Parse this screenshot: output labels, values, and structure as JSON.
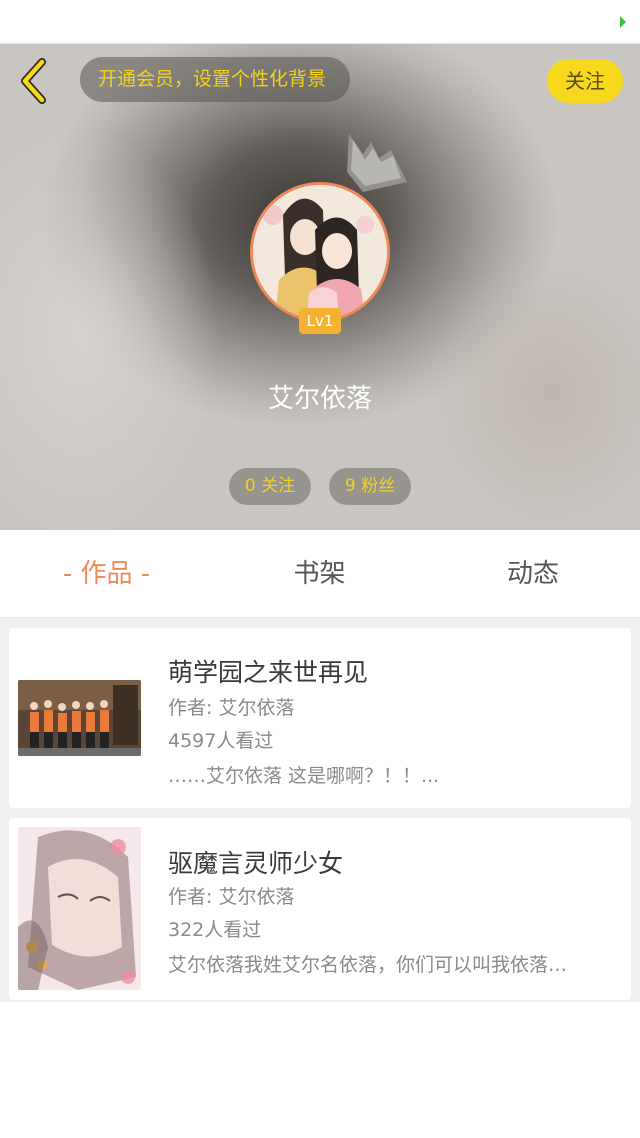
{
  "header": {
    "vip_banner": "开通会员，设置个性化背景",
    "follow_button": "关注",
    "level": "Lv1",
    "username": "艾尔依落",
    "stats": {
      "following": "0 关注",
      "fans": "9 粉丝"
    }
  },
  "tabs": [
    {
      "label": "- 作品 -",
      "active": true
    },
    {
      "label": "书架",
      "active": false
    },
    {
      "label": "动态",
      "active": false
    }
  ],
  "books": [
    {
      "title": "萌学园之来世再见",
      "author": "作者: 艾尔依落",
      "views": "4597人看过",
      "desc": "……艾尔依落 这是哪啊？！！..."
    },
    {
      "title": "驱魔言灵师少女",
      "author": "作者: 艾尔依落",
      "views": "322人看过",
      "desc": "艾尔依落我姓艾尔名依落，你们可以叫我依落…"
    }
  ],
  "colors": {
    "accent": "#f0895a",
    "yellow": "#f6d81c",
    "badge": "#f5b130"
  },
  "icons": {
    "back": "chevron-left-icon",
    "crown": "crown-icon"
  }
}
